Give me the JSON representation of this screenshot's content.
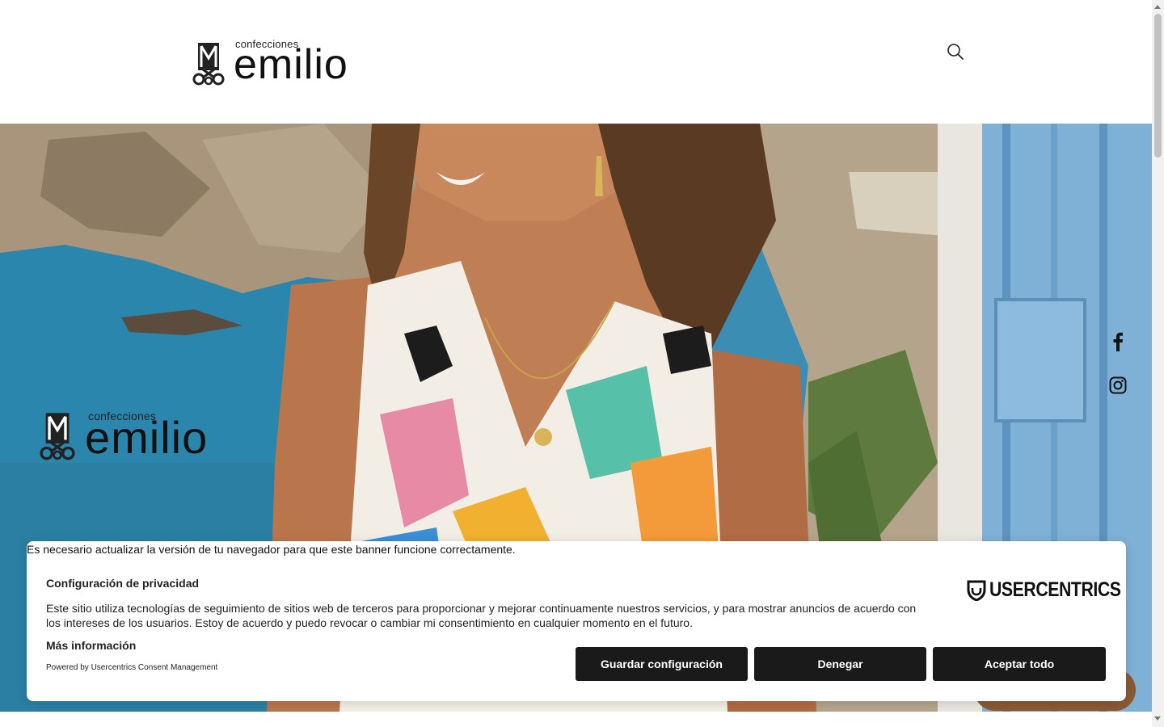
{
  "header": {
    "logo_small": "confecciones",
    "logo_big": "emilio",
    "search_icon": "search-icon"
  },
  "hero": {
    "logo_small": "confecciones",
    "logo_big": "emilio",
    "social": {
      "facebook_icon": "facebook-icon",
      "instagram_icon": "instagram-icon"
    }
  },
  "consent": {
    "warning": "Es necesario actualizar la versión de tu navegador para que este banner funcione correctamente.",
    "title": "Configuración de privacidad",
    "text": "Este sitio utiliza tecnologías de seguimiento de sitios web de terceros para proporcionar y mejorar continuamente nuestros servicios, y para mostrar anuncios de acuerdo con los intereses de los usuarios. Estoy de acuerdo y puedo revocar o cambiar mi consentimiento en cualquier momento en el futuro.",
    "more_info": "Más información",
    "powered_by": "Powered by Usercentrics Consent Management",
    "brand": "USERCENTRICS",
    "buttons": {
      "save": "Guardar configuración",
      "deny": "Denegar",
      "accept": "Aceptar todo"
    }
  },
  "colors": {
    "button_bg": "#1a1a1a",
    "button_text": "#ffffff",
    "sea": "#3e8fb5",
    "door_blue": "#7fb0d6"
  }
}
